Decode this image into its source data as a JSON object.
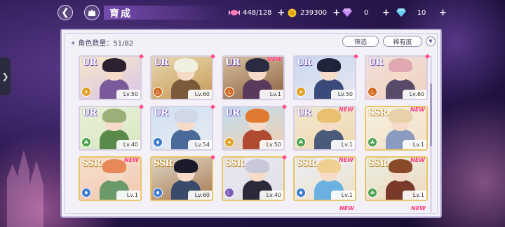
{
  "header": {
    "title": "育成",
    "stamina": "448/128",
    "coins": "239300",
    "gems_a": "0",
    "gems_b": "10",
    "plus": "+"
  },
  "panel": {
    "count_label": "角色数量：51/82",
    "filter_label": "筛选",
    "sort_label": "稀有度"
  },
  "cards": [
    {
      "rarity": "UR",
      "level": "Lv.50",
      "new": "",
      "attr": "sun-icon",
      "attr_color": "#e0a020"
    },
    {
      "rarity": "UR",
      "level": "Lv.60",
      "new": "",
      "attr": "flame-icon",
      "attr_color": "#d06a20"
    },
    {
      "rarity": "UR",
      "level": "Lv.1",
      "new": "NEW",
      "attr": "flame-icon",
      "attr_color": "#d06a20"
    },
    {
      "rarity": "UR",
      "level": "Lv.50",
      "new": "",
      "attr": "sun-icon",
      "attr_color": "#e0a020"
    },
    {
      "rarity": "UR",
      "level": "Lv.60",
      "new": "",
      "attr": "flame-icon",
      "attr_color": "#d06a20"
    },
    {
      "rarity": "UR",
      "level": "Lv.40",
      "new": "",
      "attr": "leaf-icon",
      "attr_color": "#4aa04a"
    },
    {
      "rarity": "UR",
      "level": "Lv.54",
      "new": "",
      "attr": "drop-icon",
      "attr_color": "#3a7ad0"
    },
    {
      "rarity": "UR",
      "level": "Lv.50",
      "new": "",
      "attr": "sun-icon",
      "attr_color": "#e0a020"
    },
    {
      "rarity": "UR",
      "level": "Lv.1",
      "new": "NEW",
      "attr": "leaf-icon",
      "attr_color": "#4aa04a"
    },
    {
      "rarity": "SSR",
      "level": "Lv.1",
      "new": "NEW",
      "attr": "leaf-icon",
      "attr_color": "#4aa04a"
    },
    {
      "rarity": "SSR",
      "level": "Lv.1",
      "new": "NEW",
      "attr": "drop-icon",
      "attr_color": "#3a7ad0"
    },
    {
      "rarity": "SSR",
      "level": "Lv.60",
      "new": "",
      "attr": "drop-icon",
      "attr_color": "#3a7ad0"
    },
    {
      "rarity": "SSR",
      "level": "Lv.40",
      "new": "",
      "attr": "moon-icon",
      "attr_color": "#7a5ab8"
    },
    {
      "rarity": "SSR",
      "level": "Lv.1",
      "new": "NEW",
      "attr": "drop-icon",
      "attr_color": "#3a7ad0"
    },
    {
      "rarity": "SSR",
      "level": "Lv.1",
      "new": "NEW",
      "attr": "leaf-icon",
      "attr_color": "#4aa04a"
    }
  ],
  "peek_new": [
    "NEW",
    "NEW"
  ],
  "colors": {
    "ur_border": "#d6cfe6",
    "ssr_border": "#e8c66a",
    "new_tag": "#ff3a7a",
    "panel_bg": "#f3f0f8"
  }
}
